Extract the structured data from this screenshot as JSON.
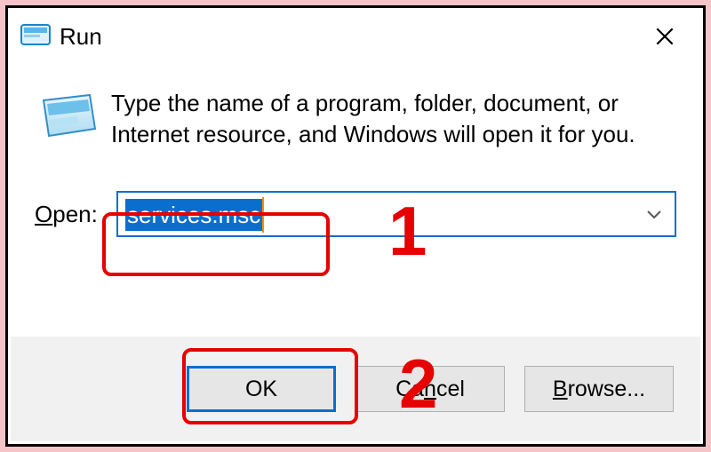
{
  "window": {
    "title": "Run",
    "description": "Type the name of a program, folder, document, or Internet resource, and Windows will open it for you."
  },
  "open": {
    "label_prefix": "O",
    "label_rest": "pen:",
    "value": "services.msc"
  },
  "buttons": {
    "ok": "OK",
    "cancel_prefix": "Ca",
    "cancel_ul": "n",
    "cancel_rest": "cel",
    "browse_ul": "B",
    "browse_rest": "rowse..."
  },
  "annotations": {
    "one": "1",
    "two": "2"
  }
}
